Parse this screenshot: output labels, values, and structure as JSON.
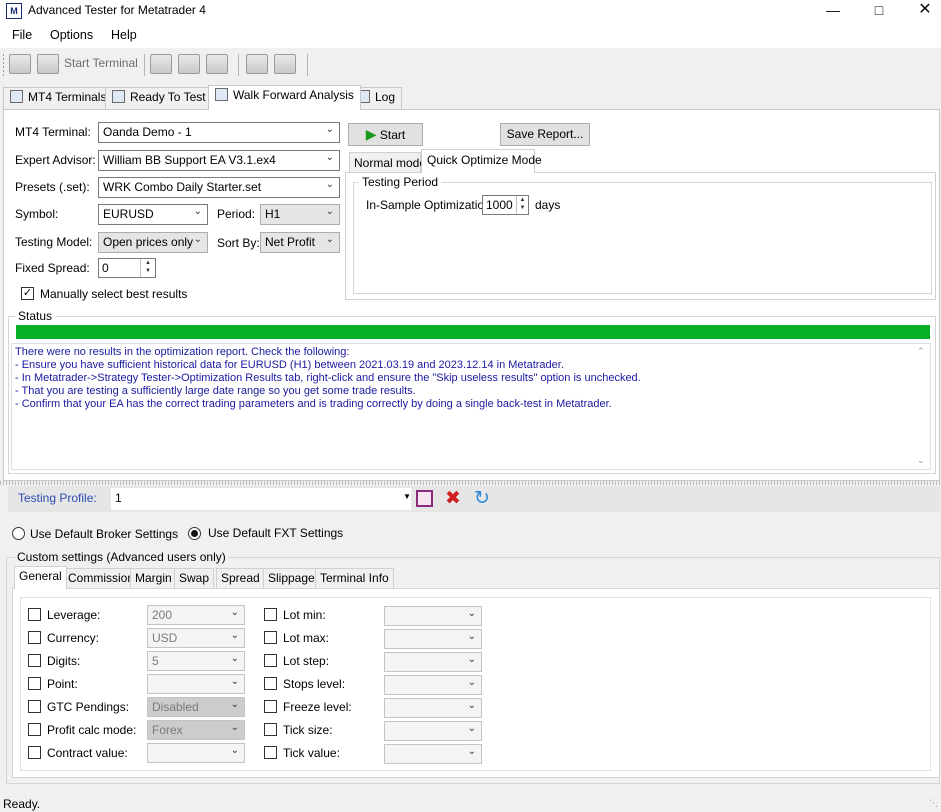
{
  "window": {
    "title": "Advanced Tester for Metatrader 4",
    "icon": "app-icon",
    "controls": [
      "minimize-icon",
      "maximize-icon",
      "close-icon"
    ]
  },
  "menu": {
    "items": [
      "File",
      "Options",
      "Help"
    ]
  },
  "toolbar": {
    "start_terminal_label": "Start Terminal"
  },
  "tabs": [
    {
      "label": "MT4 Terminals"
    },
    {
      "label": "Ready To Test"
    },
    {
      "label": "Walk Forward Analysis"
    },
    {
      "label": "Log"
    }
  ],
  "form": {
    "mt4_terminal_label": "MT4 Terminal:",
    "mt4_terminal_value": "Oanda Demo - 1",
    "expert_advisor_label": "Expert Advisor:",
    "expert_advisor_value": "William BB Support EA V3.1.ex4",
    "presets_label": "Presets (.set):",
    "presets_value": "WRK Combo Daily Starter.set",
    "symbol_label": "Symbol:",
    "symbol_value": "EURUSD",
    "period_label": "Period:",
    "period_value": "H1",
    "testing_model_label": "Testing Model:",
    "testing_model_value": "Open prices only",
    "sort_by_label": "Sort By:",
    "sort_by_value": "Net Profit",
    "fixed_spread_label": "Fixed Spread:",
    "fixed_spread_value": "0",
    "manual_select_label": "Manually select best results",
    "manual_select_checked": true
  },
  "actions": {
    "start_label": "Start",
    "save_report_label": "Save Report..."
  },
  "mode_tabs": [
    "Normal mode",
    "Quick Optimize Mode"
  ],
  "testing_period": {
    "title": "Testing Period",
    "in_sample_label": "In-Sample Optimization:",
    "in_sample_value": "1000",
    "unit": "days"
  },
  "status": {
    "title": "Status",
    "progress": 1.0,
    "progress_color": "#06b025",
    "lines": [
      "There were no results in the optimization report. Check the following:",
      "- Ensure you have sufficient historical data for EURUSD (H1) between 2021.03.19 and 2023.12.14 in Metatrader.",
      "- In Metatrader->Strategy Tester->Optimization Results tab, right-click and ensure the \"Skip useless results\" option is unchecked.",
      "- That you are testing a sufficiently large date range so you get some trade results.",
      "- Confirm that your EA has the correct trading parameters and is trading correctly by doing a single back-test in Metatrader."
    ]
  },
  "profile": {
    "label": "Testing Profile:",
    "value": "1",
    "icons": [
      "save-icon",
      "delete-icon",
      "refresh-icon"
    ]
  },
  "broker_settings": {
    "default_broker_label": "Use Default Broker Settings",
    "default_fxt_label": "Use Default FXT Settings",
    "selected": "fxt"
  },
  "custom": {
    "title": "Custom settings (Advanced users only)",
    "tabs": [
      "General",
      "Commission",
      "Margin",
      "Swap",
      "Spread",
      "Slippage",
      "Terminal Info"
    ],
    "left_fields": [
      {
        "label": "Leverage:",
        "value": "200"
      },
      {
        "label": "Currency:",
        "value": "USD"
      },
      {
        "label": "Digits:",
        "value": "5"
      },
      {
        "label": "Point:",
        "value": ""
      },
      {
        "label": "GTC Pendings:",
        "value": "Disabled"
      },
      {
        "label": "Profit calc mode:",
        "value": "Forex"
      },
      {
        "label": "Contract value:",
        "value": ""
      }
    ],
    "right_fields": [
      {
        "label": "Lot min:",
        "value": ""
      },
      {
        "label": "Lot max:",
        "value": ""
      },
      {
        "label": "Lot step:",
        "value": ""
      },
      {
        "label": "Stops level:",
        "value": ""
      },
      {
        "label": "Freeze level:",
        "value": ""
      },
      {
        "label": "Tick size:",
        "value": ""
      },
      {
        "label": "Tick value:",
        "value": ""
      }
    ]
  },
  "statusline": {
    "text": "Ready."
  }
}
